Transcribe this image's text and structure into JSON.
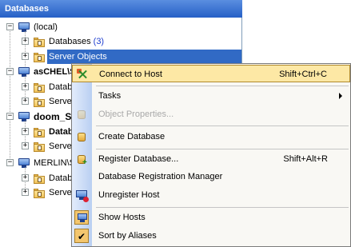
{
  "panel": {
    "title": "Databases"
  },
  "tree": {
    "hosts": [
      {
        "label": "(local)",
        "bold": false,
        "children": [
          {
            "label": "Databases",
            "count": "(3)"
          },
          {
            "label": "Server Objects",
            "selected": true
          }
        ]
      },
      {
        "label": "asCHEL\\S",
        "bold": true,
        "children": [
          {
            "label": "Datab"
          },
          {
            "label": "Serve"
          }
        ]
      },
      {
        "label": "doom_SI",
        "bold": true,
        "children": [
          {
            "label": "Datab"
          },
          {
            "label": "Serve"
          }
        ]
      },
      {
        "label": "MERLIN\\S",
        "bold": false,
        "children": [
          {
            "label": "Datab"
          },
          {
            "label": "Serve"
          }
        ]
      }
    ]
  },
  "menu": {
    "items": [
      {
        "label": "Connect to Host",
        "shortcut": "Shift+Ctrl+C",
        "icon": "connect-icon",
        "highlighted": true
      },
      {
        "label": "Tasks",
        "submenu": true
      },
      {
        "label": "Object Properties...",
        "disabled": true,
        "icon": "properties-icon"
      },
      {
        "label": "Create Database"
      },
      {
        "label": "Register Database...",
        "shortcut": "Shift+Alt+R",
        "icon": "register-database-icon"
      },
      {
        "label": "Database Registration Manager"
      },
      {
        "label": "Unregister Host",
        "icon": "unregister-host-icon"
      },
      {
        "label": "Show Hosts",
        "icon": "show-hosts-icon",
        "checked": true
      },
      {
        "label": "Sort by Aliases",
        "icon": "check-icon",
        "checked": true
      }
    ]
  },
  "colors": {
    "title_bar": "#2660c6",
    "selection": "#316ac5",
    "menu_highlight": "#fde8a5",
    "count": "#1f3fcf"
  }
}
